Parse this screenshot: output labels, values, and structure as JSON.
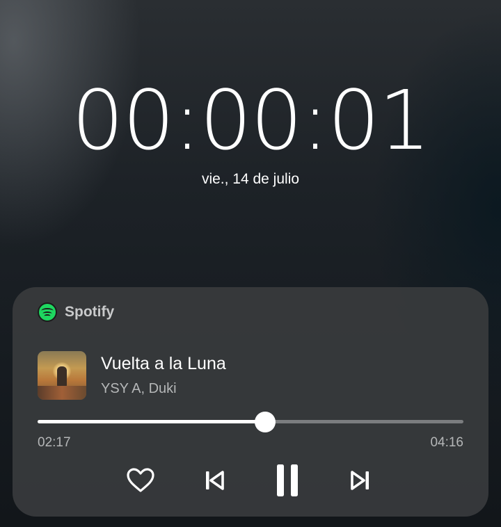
{
  "lockscreen": {
    "clock": "00:00:01",
    "date": "vie., 14 de julio"
  },
  "media_card": {
    "app_name": "Spotify",
    "app_icon": "spotify-icon",
    "album_art": "album-art",
    "track_title": "Vuelta a la Luna",
    "artist": "YSY A, Duki",
    "progress": {
      "current": "02:17",
      "total": "04:16",
      "fraction": 0.535
    },
    "controls": [
      {
        "name": "like-button",
        "icon": "heart-outline-icon"
      },
      {
        "name": "previous-button",
        "icon": "skip-previous-icon"
      },
      {
        "name": "pause-button",
        "icon": "pause-icon"
      },
      {
        "name": "next-button",
        "icon": "skip-next-icon"
      }
    ],
    "colors": {
      "card": "#37393b",
      "spotify_green": "#1ed760",
      "secondary_text": "#b5b7b8"
    }
  }
}
